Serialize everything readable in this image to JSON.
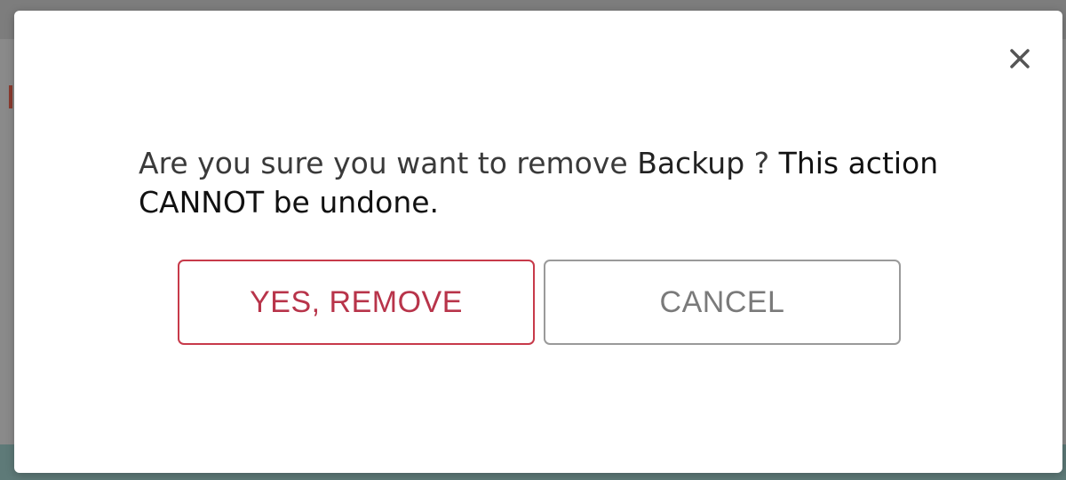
{
  "dialog": {
    "message_prefix": "Are you sure you want to remove ",
    "item_name": "Backup",
    "message_middle": " ? ",
    "message_warning": "This action CANNOT be undone.",
    "confirm_label": "YES, REMOVE",
    "cancel_label": "CANCEL",
    "close_icon": "close-icon"
  },
  "colors": {
    "danger": "#c73a4a",
    "cancel_border": "#9a9a9a",
    "cancel_text": "#7a7a7a",
    "backdrop": "#8a8a8a"
  }
}
